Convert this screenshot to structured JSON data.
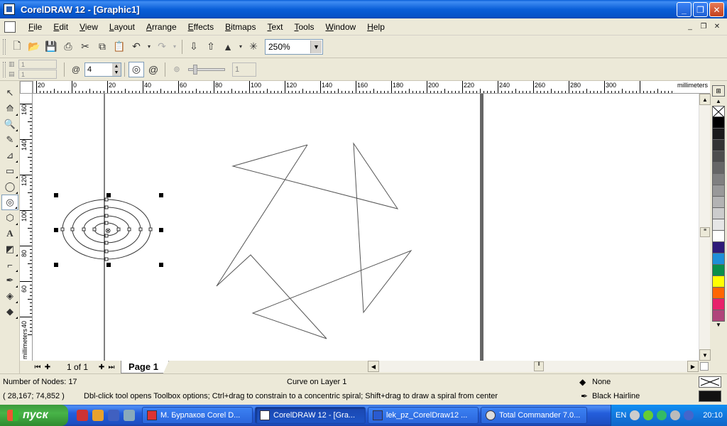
{
  "window": {
    "title": "CorelDRAW 12 - [Graphic1]"
  },
  "menu": [
    "File",
    "Edit",
    "View",
    "Layout",
    "Arrange",
    "Effects",
    "Bitmaps",
    "Text",
    "Tools",
    "Window",
    "Help"
  ],
  "toolbar": {
    "zoom": "250%"
  },
  "property_bar": {
    "row_count": "1",
    "col_count": "1",
    "spiral_revolutions": "4",
    "expansion_value": "1"
  },
  "ruler": {
    "units": "millimeters",
    "h_labels": [
      "20",
      "0",
      "20",
      "40",
      "60",
      "80",
      "100",
      "120",
      "140",
      "160",
      "180",
      "200",
      "220",
      "240",
      "260",
      "280",
      "300"
    ],
    "v_labels": [
      "160",
      "140",
      "120",
      "100",
      "80",
      "60",
      "40"
    ]
  },
  "page_nav": {
    "count": "1 of 1",
    "tab": "Page 1"
  },
  "palette": {
    "colors": [
      "#000000",
      "#1a1a1a",
      "#333333",
      "#4d4d4d",
      "#666666",
      "#808080",
      "#999999",
      "#b3b3b3",
      "#cccccc",
      "#e6e6e6",
      "#ffffff",
      "#2e1a78",
      "#1e8fd8",
      "#0a8f4a",
      "#ffff00",
      "#ff6600",
      "#e8226a",
      "#b0457a"
    ]
  },
  "status": {
    "nodes": "Number of Nodes: 17",
    "object": "Curve on Layer 1",
    "coords": "( 28,167; 74,852 )",
    "hint": "Dbl-click tool opens Toolbox options; Ctrl+drag to constrain to a concentric spiral; Shift+drag to draw a spiral from center",
    "fill": "None",
    "outline": "Black  Hairline"
  },
  "taskbar": {
    "start": "пуск",
    "tasks": [
      "М. Бурлаков Corel D...",
      "CorelDRAW 12 - [Gra...",
      "lek_pz_CorelDraw12 ...",
      "Total Commander 7.0..."
    ],
    "lang": "EN",
    "clock": "20:10"
  }
}
